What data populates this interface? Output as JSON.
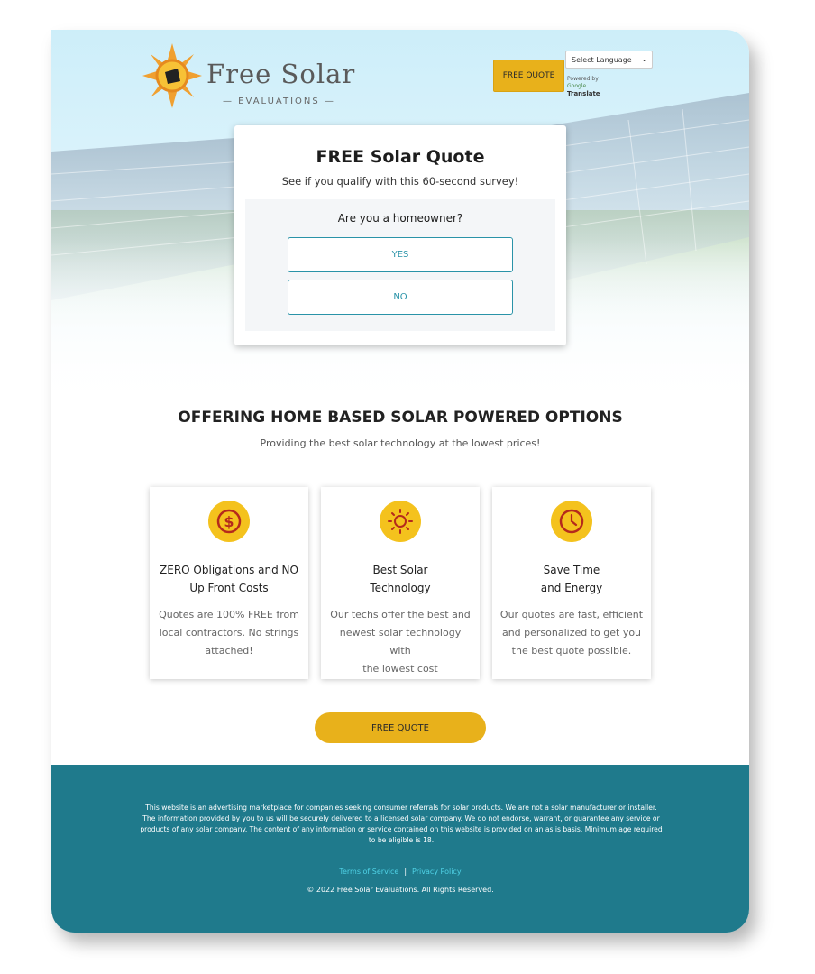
{
  "header": {
    "logo_title": "Free Solar",
    "logo_sub": "— EVALUATIONS —",
    "cta_label": "FREE QUOTE",
    "language_select": "Select Language",
    "powered_by": "Powered by",
    "google": "Google",
    "translate": "Translate"
  },
  "quote_card": {
    "title": "FREE Solar Quote",
    "subtitle": "See if you qualify with this 60-second survey!",
    "question": "Are you a homeowner?",
    "yes_label": "YES",
    "no_label": "NO"
  },
  "offering": {
    "title": "OFFERING HOME BASED SOLAR POWERED OPTIONS",
    "subtitle": "Providing the best solar technology at the lowest prices!",
    "features": [
      {
        "icon": "dollar-icon",
        "title_line1": "ZERO Obligations and NO",
        "title_line2": "Up Front Costs",
        "text_line1": "Quotes are 100% FREE from",
        "text_line2": "local contractors. No strings",
        "text_line3": "attached!"
      },
      {
        "icon": "sun-icon",
        "title_line1": "Best Solar",
        "title_line2": "Technology",
        "text_line1": "Our techs offer the best and",
        "text_line2": "newest solar technology with",
        "text_line3": "the lowest cost"
      },
      {
        "icon": "clock-icon",
        "title_line1": "Save Time",
        "title_line2": "and Energy",
        "text_line1": "Our quotes are fast, efficient",
        "text_line2": "and personalized to get you",
        "text_line3": "the best quote possible."
      }
    ],
    "cta_label": "FREE QUOTE"
  },
  "footer": {
    "disclaimer": "This website is an advertising marketplace for companies seeking consumer referrals for solar products. We are not a solar manufacturer or installer. The information provided by you to us will be securely delivered to a licensed solar company. We do not endorse, warrant, or guarantee any service or products of any solar company. The content of any information or service contained on this website is provided on an as is basis. Minimum age required to be eligible is 18.",
    "terms": "Terms of Service",
    "separator": "|",
    "privacy": "Privacy Policy",
    "copyright": "© 2022 Free Solar Evaluations. All Rights Reserved."
  },
  "colors": {
    "accent": "#e8b11b",
    "teal": "#1f7a8c",
    "button_border": "#2a93a8"
  }
}
